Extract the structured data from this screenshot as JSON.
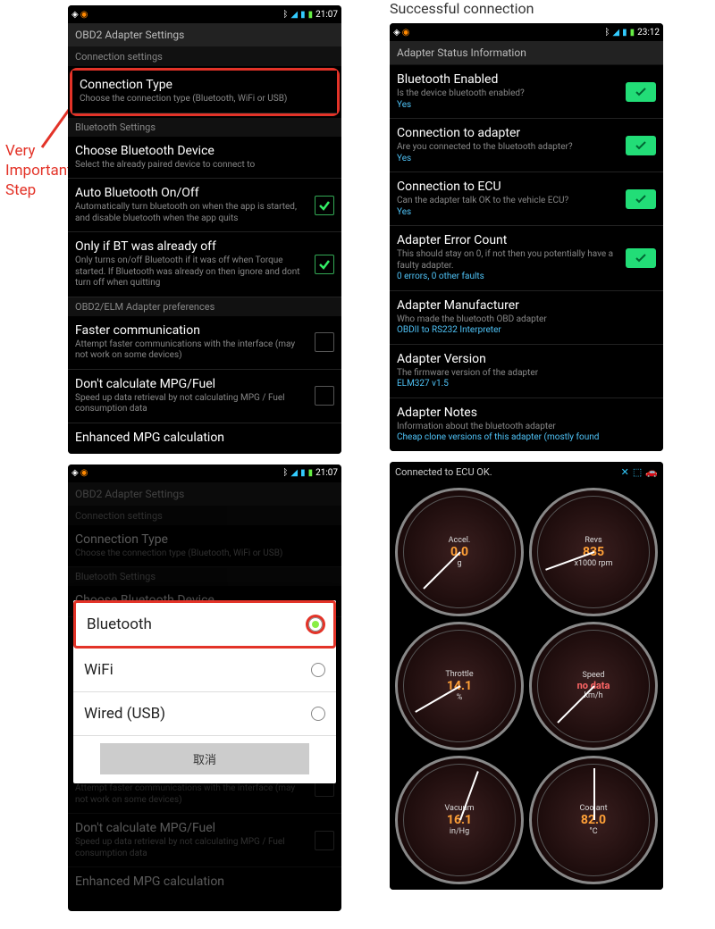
{
  "annot": {
    "line1": "Very",
    "line2": "Important",
    "line3": "Step"
  },
  "toplabel": "Successful connection",
  "status": {
    "time1": "21:07",
    "time2": "23:12"
  },
  "phone1": {
    "title": "OBD2 Adapter Settings",
    "sec_conn": "Connection settings",
    "conn_type": {
      "t": "Connection Type",
      "s": "Choose the connection type (Bluetooth, WiFi or USB)"
    },
    "sec_bt": "Bluetooth Settings",
    "choose_dev": {
      "t": "Choose Bluetooth Device",
      "s": "Select the already paired device to connect to"
    },
    "auto_bt": {
      "t": "Auto Bluetooth On/Off",
      "s": "Automatically turn bluetooth on when the app is started, and disable bluetooth when the app quits"
    },
    "only_if": {
      "t": "Only if BT was already off",
      "s": "Only turns on/off Bluetooth if it was off when Torque started. If Bluetooth was already on then ignore and dont turn off when quitting"
    },
    "sec_elm": "OBD2/ELM Adapter preferences",
    "faster": {
      "t": "Faster communication",
      "s": "Attempt faster communications with the interface (may not work on some devices)"
    },
    "mpg": {
      "t": "Don't calculate MPG/Fuel",
      "s": "Speed up data retrieval by not calculating MPG / Fuel consumption data"
    },
    "enh": {
      "t": "Enhanced MPG calculation"
    }
  },
  "phone2": {
    "title": "OBD2 Adapter Settings",
    "dialog": {
      "opt1": "Bluetooth",
      "opt2": "WiFi",
      "opt3": "Wired (USB)",
      "cancel": "取消"
    }
  },
  "phone3": {
    "title": "Adapter Status Information",
    "r1": {
      "t": "Bluetooth Enabled",
      "s": "Is the device bluetooth enabled?",
      "v": "Yes"
    },
    "r2": {
      "t": "Connection to adapter",
      "s": "Are you connected to the bluetooth adapter?",
      "v": "Yes"
    },
    "r3": {
      "t": "Connection to ECU",
      "s": "Can the adapter talk OK to the vehicle ECU?",
      "v": "Yes"
    },
    "r4": {
      "t": "Adapter Error Count",
      "s": "This should stay on 0, if not then you potentially have a faulty adapter.",
      "v": "0 errors, 0 other faults"
    },
    "r5": {
      "t": "Adapter Manufacturer",
      "s": "Who made the bluetooth OBD adapter",
      "v": "OBDII to RS232 Interpreter"
    },
    "r6": {
      "t": "Adapter Version",
      "s": "The firmware version of the adapter",
      "v": "ELM327 v1.5"
    },
    "r7": {
      "t": "Adapter Notes",
      "s": "Information about the bluetooth adapter",
      "v": "Cheap clone versions of this adapter (mostly found"
    }
  },
  "phone4": {
    "header": "Connected to ECU OK.",
    "g1": {
      "label": "Accel.",
      "val": "0.0",
      "unit": "g"
    },
    "g2": {
      "label": "Revs",
      "val": "835",
      "unit": "x1000 rpm"
    },
    "g3": {
      "label": "Throttle",
      "val": "14.1",
      "unit": "%"
    },
    "g4": {
      "label": "Speed",
      "val": "no data",
      "unit": "km/h"
    },
    "g5": {
      "label": "Vacuum",
      "val": "16.1",
      "unit": "in/Hg"
    },
    "g6": {
      "label": "Coolant",
      "val": "82.0",
      "unit": "°C"
    }
  }
}
